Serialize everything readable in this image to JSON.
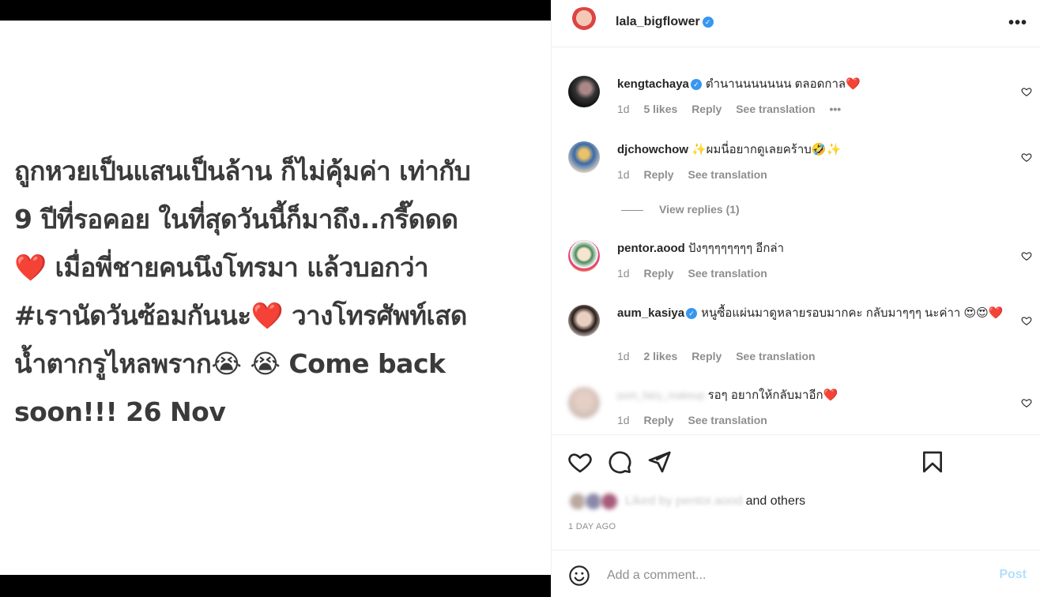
{
  "post": {
    "media_text": "ถูกหวยเป็นแสนเป็นล้าน ก็ไม่คุ้มค่า เท่ากับ\n9 ปีที่รอคอย ในที่สุดวันนี้ก็มาถึง..กรี๊ดดด\n❤️ เมื่อพี่ชายคนนึงโทรมา แล้วบอกว่า\n#เรานัดวันซ้อมกันนะ❤️ วางโทรศัพท์เสด\nน้ำตากรูไหลพราก😭 😭 Come back\nsoon!!! 26 Nov"
  },
  "header": {
    "username": "lala_bigflower",
    "more_label": "•••"
  },
  "comments": [
    {
      "user": "kengtachaya",
      "verified": true,
      "text": "ตำนานนนนนนน ตลอดกาล❤️",
      "time": "1d",
      "likes": "5 likes",
      "reply": "Reply",
      "translation": "See translation",
      "more": "•••"
    },
    {
      "user": "djchowchow",
      "verified": false,
      "text": "✨ผมนี่อยากดูเลยคร้าบ🤣✨",
      "time": "1d",
      "reply": "Reply",
      "translation": "See translation"
    },
    {
      "user": "pentor.aood",
      "verified": false,
      "text": "ปังๆๆๆๆๆๆๆๆ อีกล่า",
      "time": "1d",
      "reply": "Reply",
      "translation": "See translation"
    },
    {
      "user": "aum_kasiya",
      "verified": true,
      "text": "หนูซื้อแผ่นมาดูหลายรอบมากคะ กลับมาๆๆๆ นะค่าา 😍😍❤️",
      "time": "1d",
      "likes": "2 likes",
      "reply": "Reply",
      "translation": "See translation"
    },
    {
      "user": "pum_fairy_makeup",
      "verified": false,
      "text": "รอๆ อยากให้กลับมาอีก❤️",
      "time": "1d",
      "reply": "Reply",
      "translation": "See translation"
    }
  ],
  "view_replies": "View replies (1)",
  "likes_row": {
    "blurred_name": "Liked by pentor.aood",
    "and_others": "and others"
  },
  "timestamp": "1 DAY AGO",
  "add_comment": {
    "placeholder": "Add a comment...",
    "post_label": "Post"
  },
  "colors": {
    "verified": "#3897f0",
    "heart_red": "#ed4956",
    "muted": "#8e8e8e",
    "post_disabled": "#b2dffc"
  }
}
